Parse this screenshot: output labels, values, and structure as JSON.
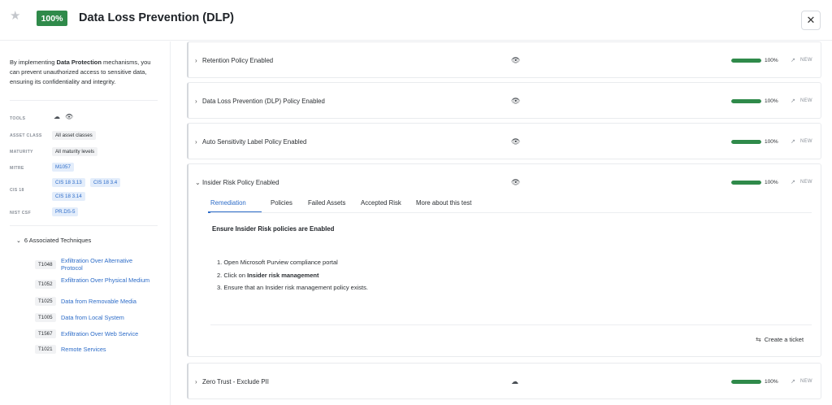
{
  "header": {
    "star_icon": "star-icon",
    "score": "100%",
    "title": "Data Loss Prevention (DLP)",
    "close_icon": "close-icon"
  },
  "colors": {
    "success": "#2f8a4a",
    "link": "#2d6cc8",
    "pill_blue_bg": "#e3edfb"
  },
  "left": {
    "intro_1": "By implementing ",
    "intro_bold": "Data Protection",
    "intro_2": " mechanisms, you can prevent unauthorized access to sensitive data, ensuring its confidentiality and integrity.",
    "labels": {
      "tools": "TOOLS",
      "asset_class": "ASSET CLASS",
      "maturity": "MATURITY",
      "mitre": "MITRE",
      "cis": "CIS 18",
      "nist": "NIST CSF"
    },
    "tools": [
      "cloud-icon",
      "eye-icon"
    ],
    "asset_class": "All asset classes",
    "maturity": "All maturity levels",
    "mitre": "M1057",
    "cis": [
      "CIS 18 3.13",
      "CIS 18 3.4",
      "CIS 18 3.14"
    ],
    "nist": "PR.DS-5",
    "associated": "6 Associated Techniques",
    "techniques": [
      {
        "id": "T1048",
        "name": "Exfiltration Over Alternative Protocol"
      },
      {
        "id": "T1052",
        "name": "Exfiltration Over Physical Medium"
      },
      {
        "id": "T1025",
        "name": "Data from Removable Media"
      },
      {
        "id": "T1005",
        "name": "Data from Local System"
      },
      {
        "id": "T1567",
        "name": "Exfiltration Over Web Service"
      },
      {
        "id": "T1021",
        "name": "Remote Services"
      }
    ]
  },
  "policies": [
    {
      "name": "Retention Policy Enabled",
      "tool_icon": "eye-icon",
      "progress": 100,
      "pct": "100%",
      "status": "NEW"
    },
    {
      "name": "Data Loss Prevention (DLP) Policy Enabled",
      "tool_icon": "eye-icon",
      "progress": 100,
      "pct": "100%",
      "status": "NEW"
    },
    {
      "name": "Auto Sensitivity Label Policy Enabled",
      "tool_icon": "eye-icon",
      "progress": 100,
      "pct": "100%",
      "status": "NEW"
    },
    {
      "name": "Insider Risk Policy Enabled",
      "tool_icon": "eye-icon",
      "progress": 100,
      "pct": "100%",
      "status": "NEW"
    },
    {
      "name": "Zero Trust - Exclude PII",
      "tool_icon": "cloud-icon",
      "progress": 100,
      "pct": "100%",
      "status": "NEW"
    }
  ],
  "expanded": {
    "tabs": [
      "Remediation",
      "Policies",
      "Failed Assets",
      "Accepted Risk",
      "More about this test"
    ],
    "active_tab": "Remediation",
    "heading": "Ensure Insider Risk policies are Enabled",
    "step1": "1. Open Microsoft Purview compliance portal",
    "step2_pre": "2. Click on ",
    "step2_bold": "Insider risk management",
    "step3": "3. Ensure that an Insider risk management policy exists.",
    "ticket": "Create a ticket"
  }
}
